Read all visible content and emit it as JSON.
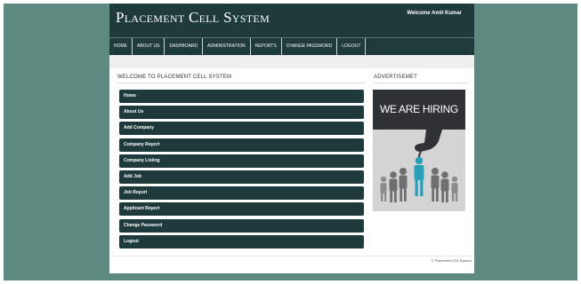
{
  "header": {
    "site_title": "Placement Cell System",
    "welcome": "Welcome Amit Kumar"
  },
  "nav": {
    "home": "HOME",
    "about": "ABOUT US",
    "dashboard": "DASHBOARD",
    "administration": "ADMINISTRATION",
    "reports": "REPORTS",
    "change_password": "CHANGE PASSWORD",
    "logout": "LOGOUT"
  },
  "main": {
    "heading": "WELCOME TO PLACEMENT CELL SYSTEM",
    "menu": {
      "home": "Home",
      "about": "About Us",
      "add_company": "Add Company",
      "company_report": "Company Report",
      "company_listing": "Company Listing",
      "add_job": "Add Job",
      "job_report": "Job Report",
      "applicant_report": "Applicant Report",
      "change_password": "Change Password",
      "logout": "Logout"
    }
  },
  "sidebar": {
    "heading": "ADVERTISEMET",
    "ad_text": "WE ARE HIRING"
  },
  "footer": {
    "copyright": "© Placement Cell System"
  },
  "colors": {
    "background": "#5f8a82",
    "primary_dark": "#1e3a3a",
    "ad_accent": "#2aa0b8"
  }
}
